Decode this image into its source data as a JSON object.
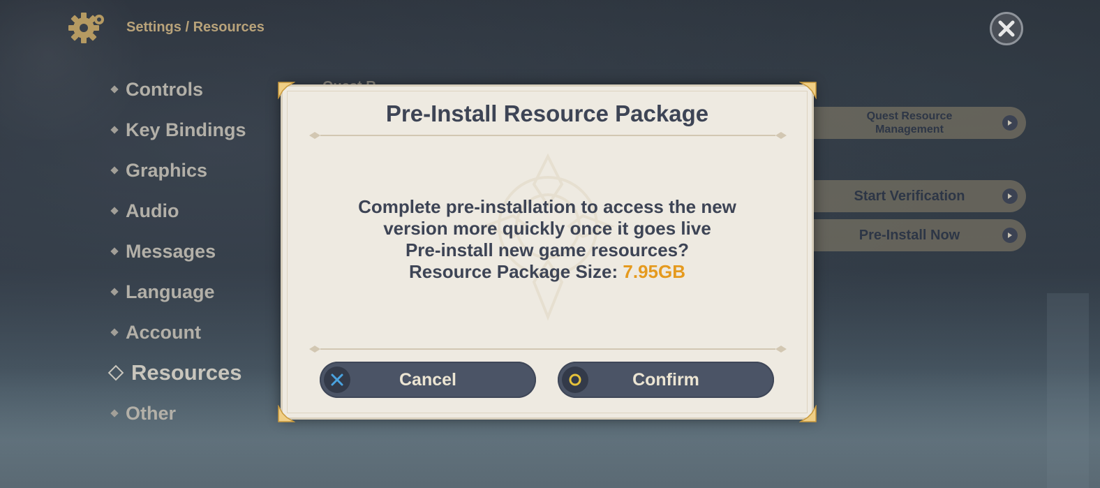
{
  "header": {
    "breadcrumb": "Settings / Resources"
  },
  "sidebar": {
    "items": [
      {
        "label": "Controls"
      },
      {
        "label": "Key Bindings"
      },
      {
        "label": "Graphics"
      },
      {
        "label": "Audio"
      },
      {
        "label": "Messages"
      },
      {
        "label": "Language"
      },
      {
        "label": "Account"
      },
      {
        "label": "Resources",
        "active": true
      },
      {
        "label": "Other"
      }
    ]
  },
  "main": {
    "obscured_heading": "Quest R",
    "buttons": [
      {
        "label_line1": "Quest Resource",
        "label_line2": "Management"
      },
      {
        "label": "Start Verification"
      },
      {
        "label": "Pre-Install Now"
      }
    ]
  },
  "dialog": {
    "title": "Pre-Install Resource Package",
    "body_line1": "Complete pre-installation to access the new",
    "body_line2": "version more quickly once it goes live",
    "body_line3": "Pre-install new game resources?",
    "size_label": "Resource Package Size: ",
    "size_value": "7.95GB",
    "cancel_label": "Cancel",
    "confirm_label": "Confirm"
  },
  "colors": {
    "accent_orange": "#e59a1e",
    "dialog_bg": "#eeeae1",
    "button_bg": "#4b5466",
    "cancel_icon": "#4aa3e0",
    "confirm_icon": "#e6c23a"
  },
  "icons": {
    "settings": "gear-icon",
    "close": "close-icon",
    "cancel": "cross-button-icon",
    "confirm": "circle-button-icon",
    "arrow": "arrow-right-icon"
  }
}
